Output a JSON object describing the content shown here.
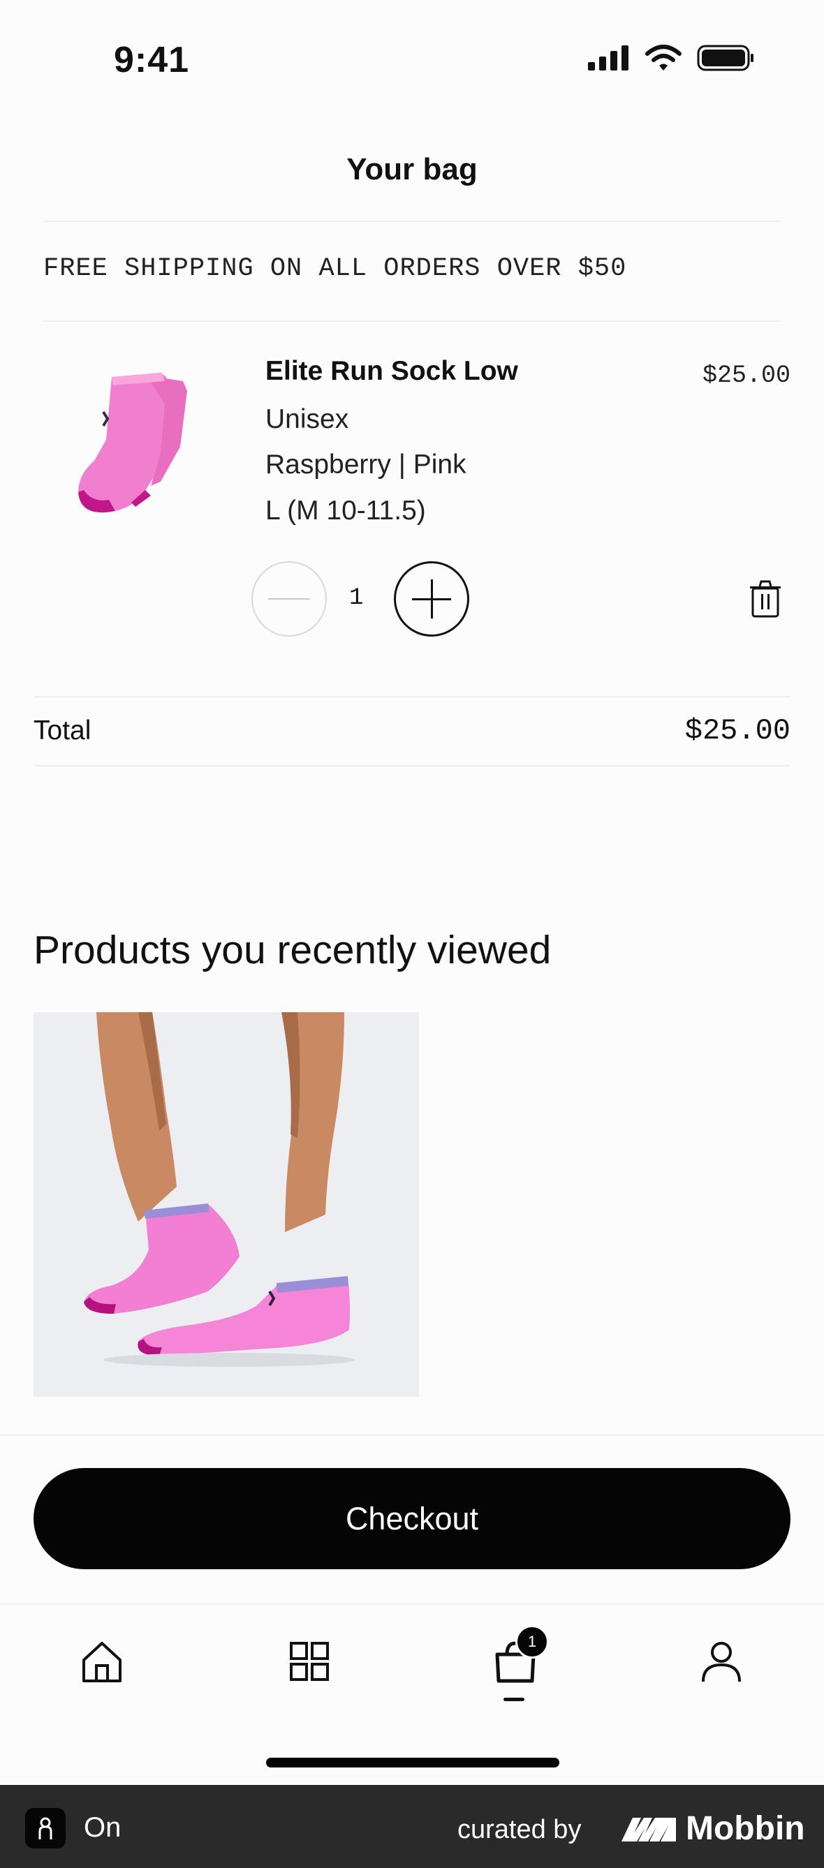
{
  "status_bar": {
    "time": "9:41"
  },
  "header": {
    "title": "Your bag"
  },
  "promo": {
    "text": "FREE SHIPPING ON ALL ORDERS OVER $50"
  },
  "cart_item": {
    "name": "Elite Run Sock Low",
    "gender": "Unisex",
    "color": "Raspberry | Pink",
    "size": "L (M 10-11.5)",
    "price": "$25.00",
    "quantity": "1"
  },
  "total": {
    "label": "Total",
    "value": "$25.00"
  },
  "recently_viewed": {
    "title": "Products you recently viewed"
  },
  "checkout": {
    "label": "Checkout"
  },
  "tab_bar": {
    "items": [
      {
        "icon": "home-icon"
      },
      {
        "icon": "grid-icon"
      },
      {
        "icon": "bag-icon",
        "active": true
      },
      {
        "icon": "profile-icon"
      }
    ],
    "bag_badge": "1"
  },
  "footer": {
    "app_name": "On",
    "curated_by": "curated by",
    "brand": "Mobbin"
  },
  "colors": {
    "accent": "#050505",
    "sock_pink": "#f07fcf",
    "background": "#fdfcfd"
  }
}
